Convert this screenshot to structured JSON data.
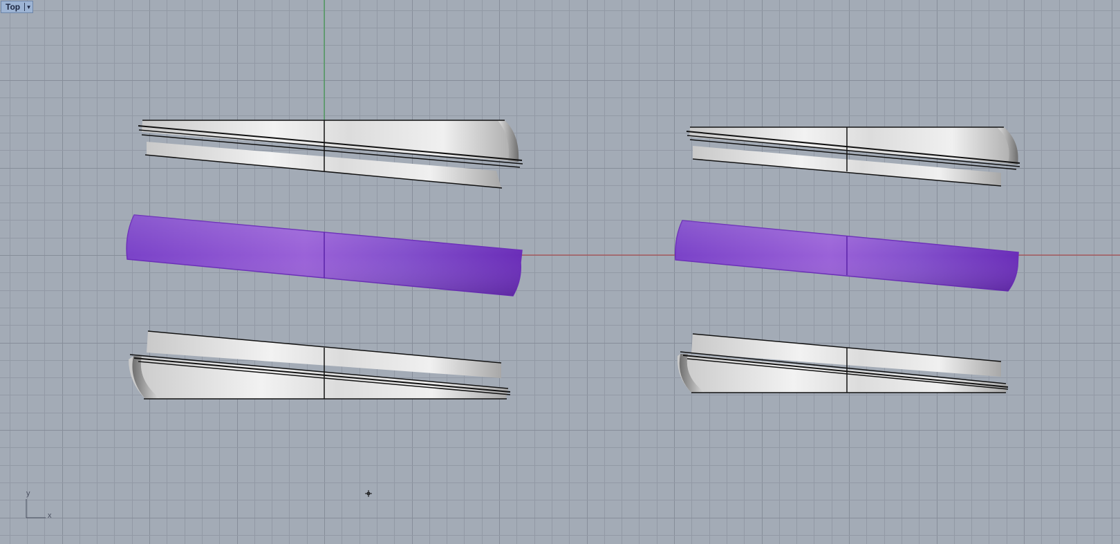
{
  "viewport": {
    "name": "Top",
    "menu_icon": "dropdown-triangle-icon",
    "background_color": "#a3abb6",
    "grid_minor_color": "#9299a5",
    "grid_major_color": "#868d99",
    "x_axis_color": "#b03a3a",
    "y_axis_color": "#2f9a3a"
  },
  "axis_widget": {
    "x_label": "x",
    "y_label": "y"
  },
  "cursor": {
    "icon": "crosshair-icon"
  },
  "objects": [
    {
      "name": "left-top-ring-half",
      "state": "unselected",
      "color": "#e2e2e2"
    },
    {
      "name": "left-middle-band",
      "state": "selected",
      "color": "#8a4fd0"
    },
    {
      "name": "left-bottom-ring-half",
      "state": "unselected",
      "color": "#e2e2e2"
    },
    {
      "name": "right-top-ring-half",
      "state": "unselected",
      "color": "#e2e2e2"
    },
    {
      "name": "right-middle-band",
      "state": "selected",
      "color": "#8a4fd0"
    },
    {
      "name": "right-bottom-ring-half",
      "state": "unselected",
      "color": "#e2e2e2"
    }
  ]
}
